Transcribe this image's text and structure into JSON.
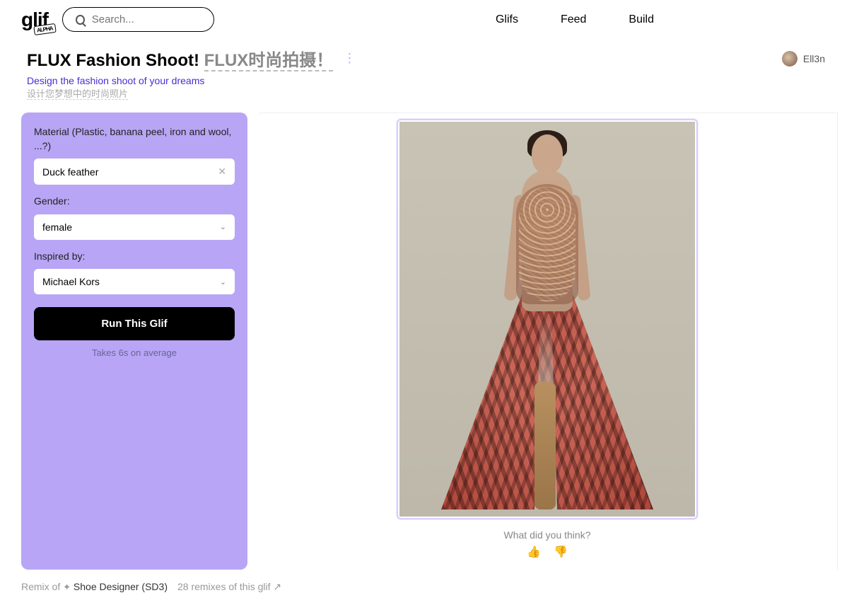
{
  "header": {
    "logo_text": "glif",
    "logo_badge": "ALPHA",
    "search_placeholder": "Search...",
    "nav": {
      "glifs": "Glifs",
      "feed": "Feed",
      "build": "Build"
    }
  },
  "page": {
    "title_main": "FLUX Fashion Shoot! ",
    "title_trans": "FLUX时尚拍摄！",
    "subtitle": "Design the fashion shoot of your dreams",
    "subtitle_trans": "设计您梦想中的时尚照片",
    "username": "Ell3n"
  },
  "form": {
    "material_label": "Material (Plastic, banana peel, iron and wool, ...?)",
    "material_value": "Duck feather",
    "gender_label": "Gender:",
    "gender_value": "female",
    "inspired_label": "Inspired by:",
    "inspired_value": "Michael Kors",
    "run_label": "Run This Glif",
    "avg_text": "Takes 6s on average"
  },
  "output": {
    "feedback_prompt": "What did you think?"
  },
  "footer": {
    "remix_prefix": "Remix of ",
    "remix_name": "Shoe Designer (SD3)",
    "remixes_count": "28 remixes of this glif ↗"
  }
}
